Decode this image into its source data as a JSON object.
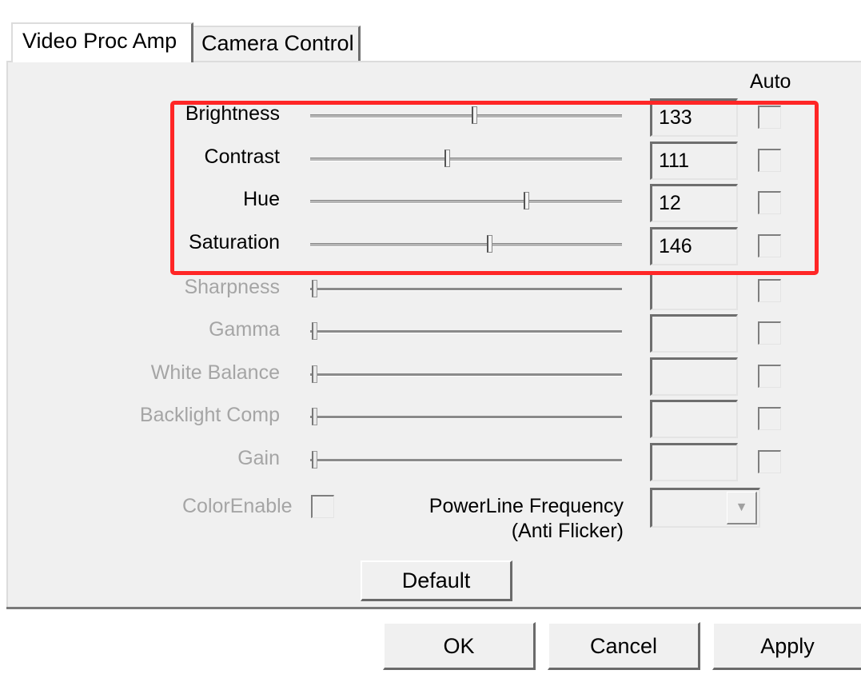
{
  "tabs": [
    {
      "label": "Video Proc Amp",
      "active": true
    },
    {
      "label": "Camera Control",
      "active": false
    }
  ],
  "auto_header": "Auto",
  "properties": [
    {
      "label": "Brightness",
      "value": "133",
      "enabled": true,
      "slider_position": 0.53
    },
    {
      "label": "Contrast",
      "value": "111",
      "enabled": true,
      "slider_position": 0.44
    },
    {
      "label": "Hue",
      "value": "12",
      "enabled": true,
      "slider_position": 0.7
    },
    {
      "label": "Saturation",
      "value": "146",
      "enabled": true,
      "slider_position": 0.58
    },
    {
      "label": "Sharpness",
      "value": "",
      "enabled": false,
      "slider_position": 0
    },
    {
      "label": "Gamma",
      "value": "",
      "enabled": false,
      "slider_position": 0
    },
    {
      "label": "White Balance",
      "value": "",
      "enabled": false,
      "slider_position": 0
    },
    {
      "label": "Backlight Comp",
      "value": "",
      "enabled": false,
      "slider_position": 0
    },
    {
      "label": "Gain",
      "value": "",
      "enabled": false,
      "slider_position": 0
    }
  ],
  "color_enable_label": "ColorEnable",
  "powerline_label_line1": "PowerLine Frequency",
  "powerline_label_line2": "(Anti Flicker)",
  "default_button": "Default",
  "ok_button": "OK",
  "cancel_button": "Cancel",
  "apply_button": "Apply",
  "colors": {
    "highlight": "#ff2626",
    "panel": "#f0f0f0",
    "disabled_text": "#a5a5a5"
  }
}
